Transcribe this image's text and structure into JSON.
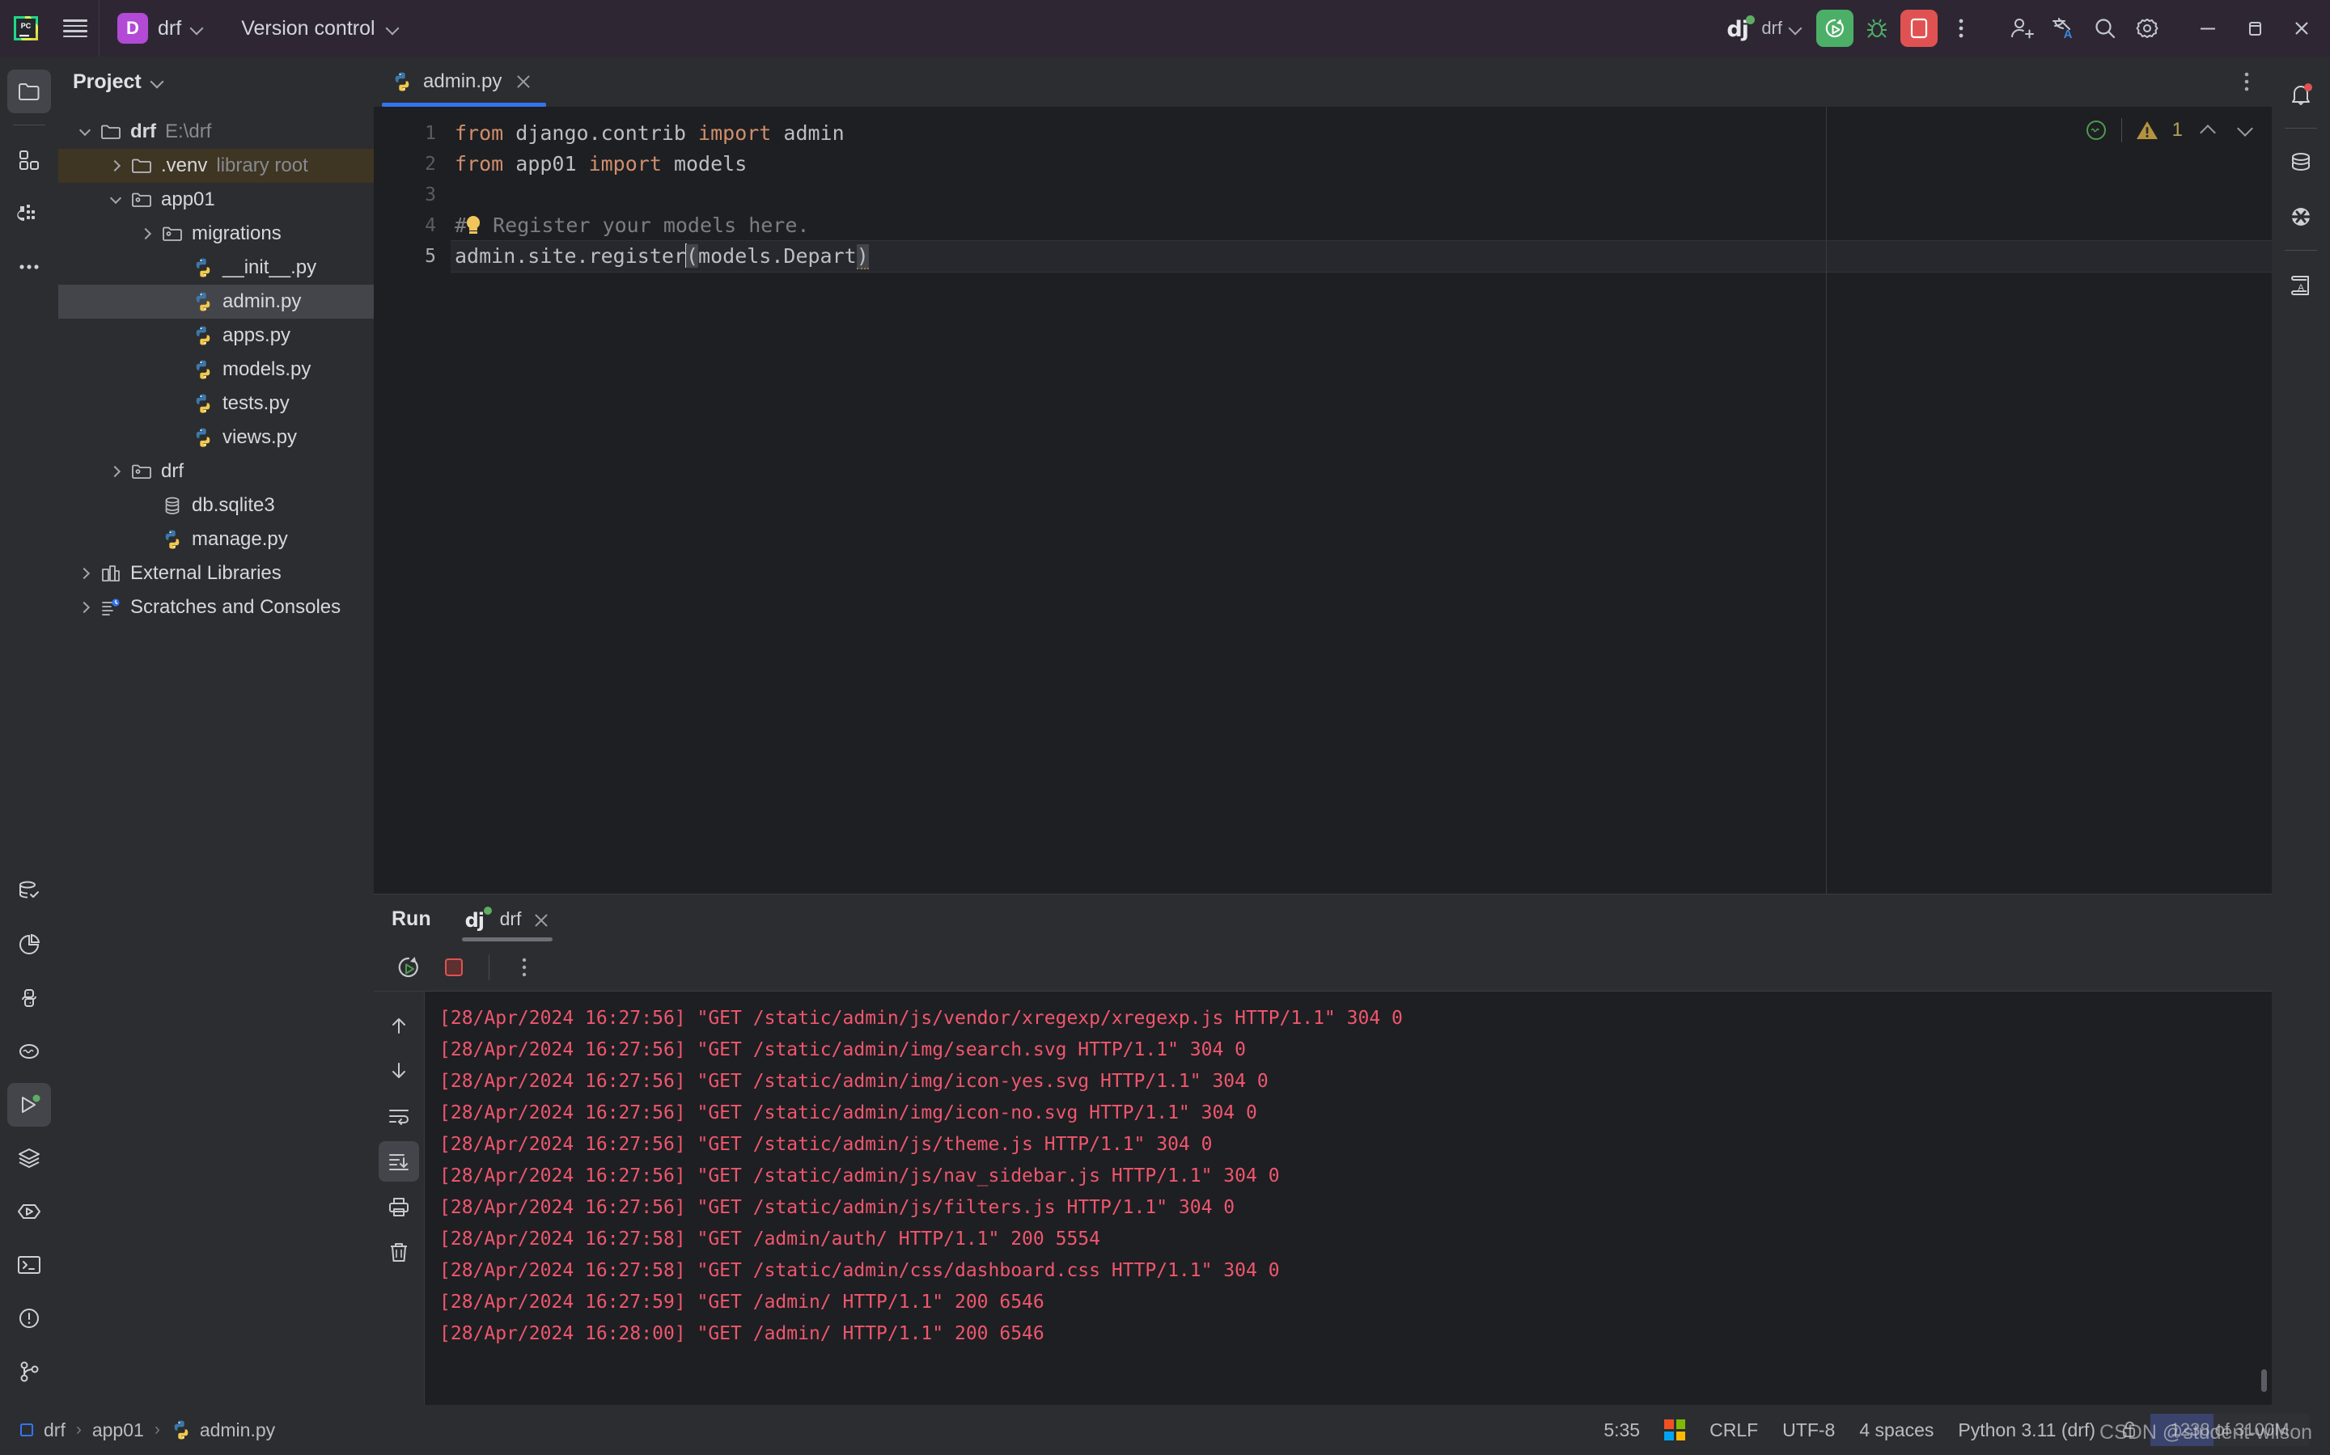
{
  "titlebar": {
    "app_logo": "pycharm-logo",
    "menu_icon": "hamburger-menu-icon",
    "project_badge": "D",
    "project_name": "drf",
    "vcs_label": "Version control",
    "run_config_name": "drf",
    "run_icon": "run-icon",
    "debug_icon": "debug-icon",
    "stop_icon": "stop-icon",
    "more_icon": "more-vertical-icon",
    "add_user_icon": "add-user-icon",
    "translate_icon": "translate-icon",
    "search_icon": "search-icon",
    "settings_icon": "gear-icon",
    "minimize_icon": "minimize-icon",
    "maximize_icon": "maximize-icon",
    "close_icon": "close-icon",
    "accent_run": "#4caf67",
    "accent_stop": "#e05252",
    "accent_badge": "#b24ad6"
  },
  "left_rail": {
    "items": [
      {
        "name": "project-tool-window",
        "icon": "folder-icon",
        "active": true
      },
      {
        "name": "structure-tool-window",
        "icon": "structure-icon",
        "active": false
      },
      {
        "name": "django-tool-window",
        "icon": "django-icon",
        "active": false
      },
      {
        "name": "more-tool-windows",
        "icon": "ellipsis-icon",
        "active": false
      }
    ],
    "bottom_items": [
      {
        "name": "database-tool-window",
        "icon": "database-check-icon",
        "active": false
      },
      {
        "name": "profiler-tool-window",
        "icon": "pie-chart-icon",
        "active": false
      },
      {
        "name": "python-packages-tool-window",
        "icon": "python-icon",
        "active": false
      },
      {
        "name": "problems-tool-window",
        "icon": "inspection-icon",
        "active": false
      },
      {
        "name": "run-tool-window",
        "icon": "run-triangle-icon",
        "active": true
      },
      {
        "name": "services-tool-window",
        "icon": "layers-icon",
        "active": false
      },
      {
        "name": "python-console-tool-window",
        "icon": "python-console-icon",
        "active": false
      },
      {
        "name": "terminal-tool-window",
        "icon": "terminal-icon",
        "active": false
      },
      {
        "name": "problems-alert-tool-window",
        "icon": "exclamation-circle-icon",
        "active": false
      },
      {
        "name": "version-control-tool-window",
        "icon": "git-branch-icon",
        "active": false
      }
    ]
  },
  "right_rail": {
    "items": [
      {
        "name": "notifications",
        "icon": "bell-icon",
        "badge": true
      },
      {
        "name": "database",
        "icon": "database-icon",
        "badge": false
      },
      {
        "name": "ai-assistant",
        "icon": "x-circle-icon",
        "badge": false
      },
      {
        "name": "learn",
        "icon": "book-a-icon",
        "badge": false
      }
    ]
  },
  "project": {
    "header_title": "Project",
    "header_chevron": "chevron-down-icon",
    "tree": [
      {
        "label": "drf",
        "sub": "E:\\drf",
        "icon": "folder-icon",
        "arrow": "down",
        "indent": 0,
        "bold": true,
        "state": "normal"
      },
      {
        "label": ".venv",
        "sub": "library root",
        "icon": "folder-icon",
        "arrow": "right",
        "indent": 1,
        "bold": false,
        "state": "venv"
      },
      {
        "label": "app01",
        "sub": "",
        "icon": "module-folder-icon",
        "arrow": "down",
        "indent": 1,
        "bold": false,
        "state": "normal"
      },
      {
        "label": "migrations",
        "sub": "",
        "icon": "module-folder-icon",
        "arrow": "right",
        "indent": 2,
        "bold": false,
        "state": "normal"
      },
      {
        "label": "__init__.py",
        "sub": "",
        "icon": "python-file-icon",
        "arrow": "none",
        "indent": 3,
        "bold": false,
        "state": "normal"
      },
      {
        "label": "admin.py",
        "sub": "",
        "icon": "python-file-icon",
        "arrow": "none",
        "indent": 3,
        "bold": false,
        "state": "selected"
      },
      {
        "label": "apps.py",
        "sub": "",
        "icon": "python-file-icon",
        "arrow": "none",
        "indent": 3,
        "bold": false,
        "state": "normal"
      },
      {
        "label": "models.py",
        "sub": "",
        "icon": "python-file-icon",
        "arrow": "none",
        "indent": 3,
        "bold": false,
        "state": "normal"
      },
      {
        "label": "tests.py",
        "sub": "",
        "icon": "python-file-icon",
        "arrow": "none",
        "indent": 3,
        "bold": false,
        "state": "normal"
      },
      {
        "label": "views.py",
        "sub": "",
        "icon": "python-file-icon",
        "arrow": "none",
        "indent": 3,
        "bold": false,
        "state": "normal"
      },
      {
        "label": "drf",
        "sub": "",
        "icon": "module-folder-icon",
        "arrow": "right",
        "indent": 1,
        "bold": false,
        "state": "normal"
      },
      {
        "label": "db.sqlite3",
        "sub": "",
        "icon": "database-file-icon",
        "arrow": "none",
        "indent": 2,
        "bold": false,
        "state": "normal"
      },
      {
        "label": "manage.py",
        "sub": "",
        "icon": "python-file-icon",
        "arrow": "none",
        "indent": 2,
        "bold": false,
        "state": "normal"
      },
      {
        "label": "External Libraries",
        "sub": "",
        "icon": "libraries-icon",
        "arrow": "right",
        "indent": 0,
        "bold": false,
        "state": "normal"
      },
      {
        "label": "Scratches and Consoles",
        "sub": "",
        "icon": "scratches-icon",
        "arrow": "right",
        "indent": 0,
        "bold": false,
        "state": "normal"
      }
    ]
  },
  "editor": {
    "tab_label": "admin.py",
    "tab_icon": "python-file-icon",
    "tab_close_icon": "close-icon",
    "tabbar_more_icon": "more-vertical-icon",
    "more_options_icon": "more-vertical-icon",
    "line_numbers": [
      "1",
      "2",
      "3",
      "4",
      "5"
    ],
    "current_line": 5,
    "lines": [
      {
        "n": "1",
        "segments": [
          {
            "t": "from ",
            "c": "kw"
          },
          {
            "t": "django.contrib ",
            "c": "txt"
          },
          {
            "t": "import ",
            "c": "kw"
          },
          {
            "t": "admin",
            "c": "txt"
          }
        ]
      },
      {
        "n": "2",
        "segments": [
          {
            "t": "from ",
            "c": "kw"
          },
          {
            "t": "app01 ",
            "c": "txt"
          },
          {
            "t": "import ",
            "c": "kw"
          },
          {
            "t": "models",
            "c": "txt"
          }
        ]
      },
      {
        "n": "3",
        "segments": []
      },
      {
        "n": "4",
        "segments": [
          {
            "t": "# Register your models here.",
            "c": "cmt"
          }
        ]
      },
      {
        "n": "5",
        "segments": [
          {
            "t": "admin.site.register(models.Depart)",
            "c": "txt"
          }
        ]
      }
    ],
    "raw_text": "from django.contrib import admin\nfrom app01 import models\n\n# Register your models here.\nadmin.site.register(models.Depart)",
    "inspection": {
      "status_icon": "inspection-ok-icon",
      "warning_icon": "warning-triangle-icon",
      "warning_count": "1",
      "prev_icon": "chevron-up-icon",
      "next_icon": "chevron-down-icon"
    }
  },
  "run_panel": {
    "title": "Run",
    "tab_label": "drf",
    "tab_icon": "django-icon",
    "tab_close_icon": "close-icon",
    "toolbar": [
      {
        "name": "rerun-button",
        "icon": "rerun-icon"
      },
      {
        "name": "stop-button",
        "icon": "stop-square-icon"
      },
      {
        "name": "more-button",
        "icon": "more-vertical-icon"
      }
    ],
    "console_rail": [
      {
        "name": "scroll-up-button",
        "icon": "arrow-up-icon",
        "active": false
      },
      {
        "name": "scroll-down-button",
        "icon": "arrow-down-icon",
        "active": false
      },
      {
        "name": "soft-wrap-button",
        "icon": "soft-wrap-icon",
        "active": false
      },
      {
        "name": "scroll-to-end-button",
        "icon": "scroll-to-end-icon",
        "active": true
      },
      {
        "name": "print-button",
        "icon": "printer-icon",
        "active": false
      },
      {
        "name": "clear-all-button",
        "icon": "trash-icon",
        "active": false
      }
    ],
    "log_color": "#f0566e",
    "log_lines": [
      "[28/Apr/2024 16:27:56] \"GET /static/admin/js/vendor/xregexp/xregexp.js HTTP/1.1\" 304 0",
      "[28/Apr/2024 16:27:56] \"GET /static/admin/img/search.svg HTTP/1.1\" 304 0",
      "[28/Apr/2024 16:27:56] \"GET /static/admin/img/icon-yes.svg HTTP/1.1\" 304 0",
      "[28/Apr/2024 16:27:56] \"GET /static/admin/img/icon-no.svg HTTP/1.1\" 304 0",
      "[28/Apr/2024 16:27:56] \"GET /static/admin/js/theme.js HTTP/1.1\" 304 0",
      "[28/Apr/2024 16:27:56] \"GET /static/admin/js/nav_sidebar.js HTTP/1.1\" 304 0",
      "[28/Apr/2024 16:27:56] \"GET /static/admin/js/filters.js HTTP/1.1\" 304 0",
      "[28/Apr/2024 16:27:58] \"GET /admin/auth/ HTTP/1.1\" 200 5554",
      "[28/Apr/2024 16:27:58] \"GET /static/admin/css/dashboard.css HTTP/1.1\" 304 0",
      "[28/Apr/2024 16:27:59] \"GET /admin/ HTTP/1.1\" 200 6546",
      "[28/Apr/2024 16:28:00] \"GET /admin/ HTTP/1.1\" 200 6546"
    ]
  },
  "statusbar": {
    "breadcrumb": [
      {
        "label": "drf",
        "icon": "module-icon"
      },
      {
        "label": "app01",
        "icon": ""
      },
      {
        "label": "admin.py",
        "icon": "python-file-icon"
      }
    ],
    "separator": "›",
    "caret_position": "5:35",
    "os_icon": "windows-icon",
    "line_separator": "CRLF",
    "encoding": "UTF-8",
    "indent": "4 spaces",
    "interpreter": "Python 3.11 (drf)",
    "lock_icon": "lock-icon",
    "memory": "1238 of 3100M",
    "watermark": "CSDN @student-wilson"
  }
}
